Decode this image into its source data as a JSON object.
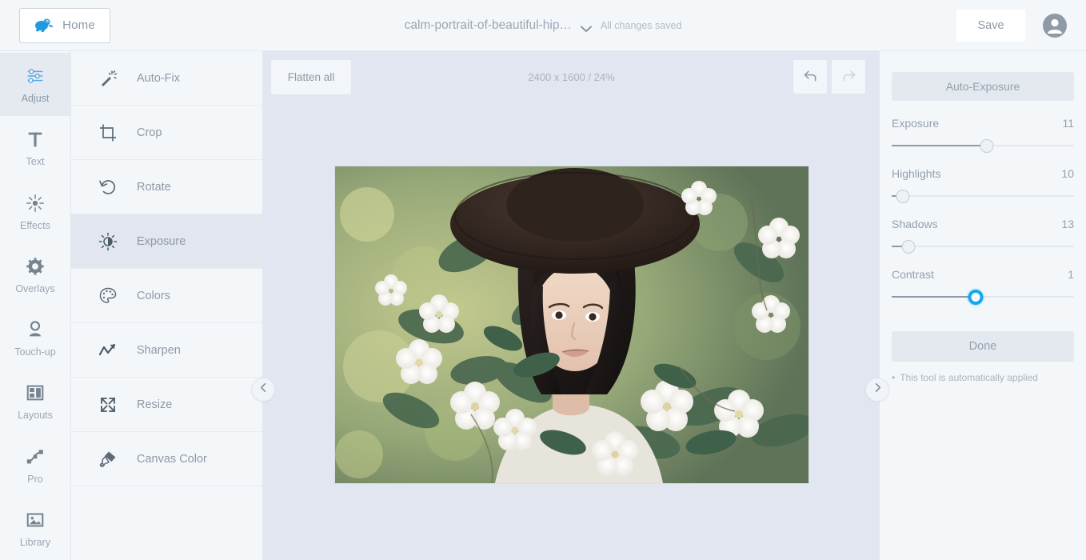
{
  "header": {
    "home_label": "Home",
    "home_icon": "frog-logo-icon",
    "doc_title": "calm-portrait-of-beautiful-hip…",
    "title_chevron_icon": "chevron-down-icon",
    "save_status": "All changes saved",
    "save_label": "Save",
    "avatar_icon": "user-avatar-icon"
  },
  "rail": {
    "items": [
      {
        "label": "Adjust",
        "icon": "sliders-icon",
        "active": true
      },
      {
        "label": "Text",
        "icon": "text-t-icon",
        "active": false
      },
      {
        "label": "Effects",
        "icon": "sparkle-sun-icon",
        "active": false
      },
      {
        "label": "Overlays",
        "icon": "gear-flower-icon",
        "active": false
      },
      {
        "label": "Touch-up",
        "icon": "person-icon",
        "active": false
      },
      {
        "label": "Layouts",
        "icon": "grid-layout-icon",
        "active": false
      },
      {
        "label": "Pro",
        "icon": "nodes-icon",
        "active": false
      },
      {
        "label": "Library",
        "icon": "image-icon",
        "active": false
      }
    ]
  },
  "tools": {
    "items": [
      {
        "label": "Auto-Fix",
        "icon": "magic-wand-icon",
        "selected": false
      },
      {
        "label": "Crop",
        "icon": "crop-icon",
        "selected": false
      },
      {
        "label": "Rotate",
        "icon": "rotate-ccw-icon",
        "selected": false
      },
      {
        "label": "Exposure",
        "icon": "exposure-sun-icon",
        "selected": true
      },
      {
        "label": "Colors",
        "icon": "palette-icon",
        "selected": false
      },
      {
        "label": "Sharpen",
        "icon": "sharpen-arrow-icon",
        "selected": false
      },
      {
        "label": "Resize",
        "icon": "resize-arrows-icon",
        "selected": false
      },
      {
        "label": "Canvas Color",
        "icon": "paint-brush-icon",
        "selected": false
      }
    ]
  },
  "canvas": {
    "flatten_label": "Flatten all",
    "dimensions": "2400 x 1600 / 24%",
    "undo_icon": "undo-arrow-icon",
    "redo_icon": "redo-arrow-icon",
    "collapse_left_icon": "chevron-left-icon",
    "collapse_right_icon": "chevron-right-icon",
    "photo_alt": "portrait of woman in dark hat among white blossoms"
  },
  "right_panel": {
    "auto_label": "Auto-Exposure",
    "sliders": [
      {
        "name": "Exposure",
        "value": "11",
        "percent": 52,
        "active": false
      },
      {
        "name": "Highlights",
        "value": "10",
        "percent": 6,
        "active": false
      },
      {
        "name": "Shadows",
        "value": "13",
        "percent": 9,
        "active": false
      },
      {
        "name": "Contrast",
        "value": "1",
        "percent": 46,
        "active": true
      }
    ],
    "done_label": "Done",
    "note_bullet": "•",
    "note_text": "This tool is automatically applied"
  },
  "colors": {
    "accent": "#15a6f0",
    "panel_bg": "#f4f7fa",
    "canvas_bg": "#e2e6f0",
    "selected_tool_bg": "#e2e6ee",
    "text_muted": "#93a0ad"
  }
}
